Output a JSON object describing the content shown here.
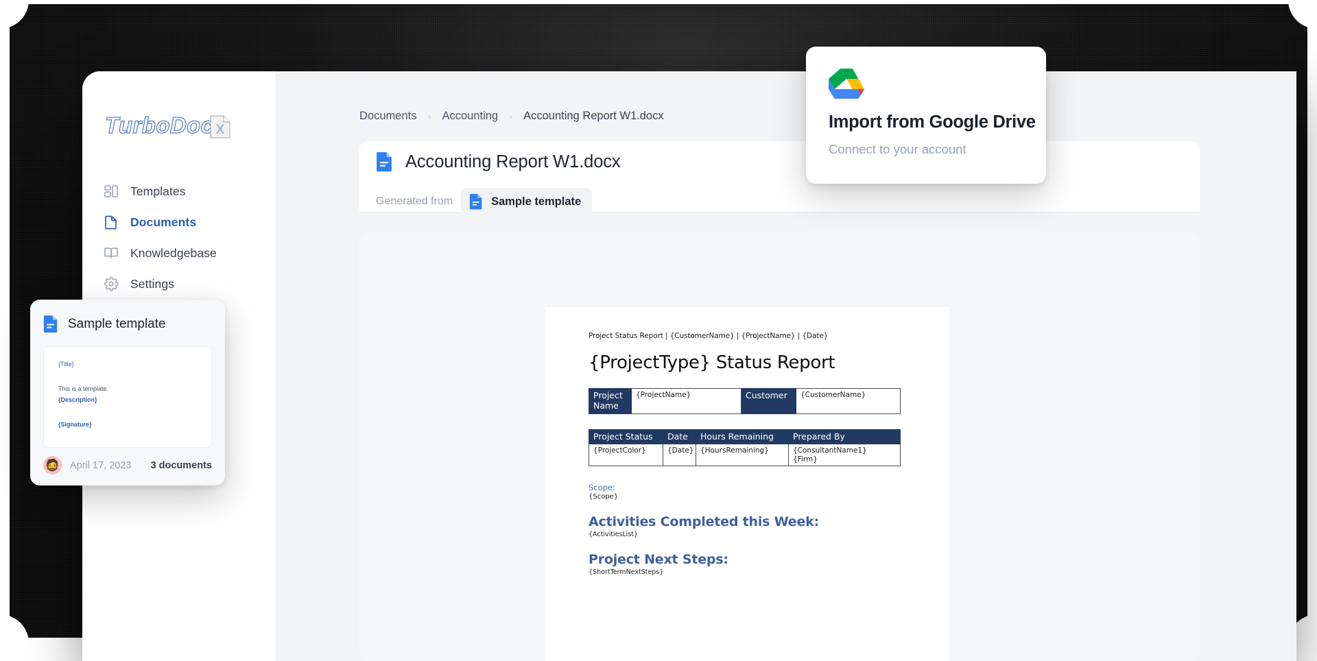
{
  "app": {
    "logo_text": "TurboDoc",
    "logo_badge": "X"
  },
  "sidebar": {
    "items": [
      {
        "label": "Templates",
        "icon": "grid-icon",
        "active": false
      },
      {
        "label": "Documents",
        "icon": "document-icon",
        "active": true
      },
      {
        "label": "Knowledgebase",
        "icon": "book-icon",
        "active": false
      },
      {
        "label": "Settings",
        "icon": "gear-icon",
        "active": false
      }
    ]
  },
  "breadcrumb": {
    "items": [
      "Documents",
      "Accounting",
      "Accounting Report W1.docx"
    ],
    "separator": "›"
  },
  "header": {
    "doc_title": "Accounting Report W1.docx",
    "doc_icon": "blue-docx-file-icon",
    "generated_from_label": "Generated from",
    "template_chip_label": "Sample template",
    "template_chip_icon": "blue-docx-file-icon"
  },
  "document_preview": {
    "header_line": "Project Status Report | {CustomerName} | {ProjectName} | {Date}",
    "title": "{ProjectType} Status Report",
    "table1": {
      "cells": [
        {
          "text": "Project Name",
          "header": true
        },
        {
          "text": "{ProjectName}",
          "header": false
        },
        {
          "text": "Customer",
          "header": true
        },
        {
          "text": "{CustomerName}",
          "header": false
        }
      ]
    },
    "table2": {
      "headers": [
        "Project Status",
        "Date",
        "Hours Remaining",
        "Prepared By"
      ],
      "row": [
        "{ProjectColor}",
        "{Date}",
        "{HoursRemaining}",
        "{ConsultantName1}\n{Firm}"
      ]
    },
    "scope_label": "Scope:",
    "scope_value": "{Scope}",
    "activities_heading": "Activities Completed this Week:",
    "activities_value": "{ActivitiesList}",
    "nextsteps_heading": "Project Next Steps:",
    "nextsteps_value": "{ShortTermNextSteps}"
  },
  "gdrive_card": {
    "icon": "google-drive-icon",
    "title": "Import from Google Drive",
    "subtitle": "Connect to your account"
  },
  "template_card": {
    "icon": "blue-docx-file-icon",
    "title": "Sample template",
    "preview": {
      "line1": "{Title}",
      "line2": "This is a template.",
      "line3": "{Description}",
      "line4": "{Signature}"
    },
    "avatar": "🧔",
    "date": "April 17, 2023",
    "count": "3 documents"
  },
  "colors": {
    "accent_blue": "#2a5db0",
    "doc_icon_blue": "#2f7ff0",
    "doc_table_header": "#223a63",
    "doc_heading_blue": "#3f5f9e",
    "muted_text": "#9aa3b2"
  }
}
